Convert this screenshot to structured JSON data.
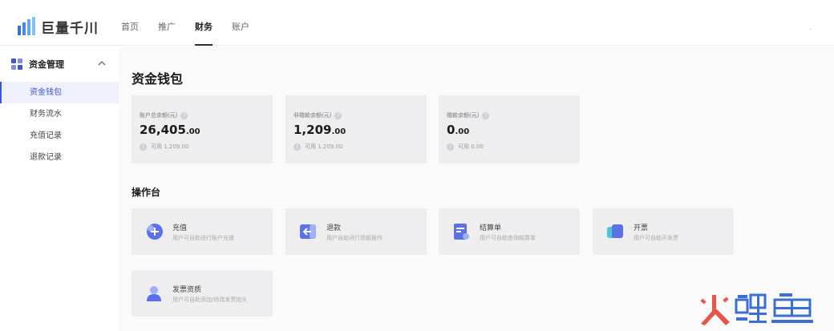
{
  "header": {
    "logo_text": "巨量千川",
    "nav": [
      {
        "label": "首页",
        "active": false
      },
      {
        "label": "推广",
        "active": false
      },
      {
        "label": "财务",
        "active": true
      },
      {
        "label": "账户",
        "active": false
      }
    ],
    "right_mark": "."
  },
  "sidebar": {
    "group_label": "资金管理",
    "items": [
      {
        "label": "资金钱包",
        "active": true
      },
      {
        "label": "财务流水",
        "active": false
      },
      {
        "label": "充值记录",
        "active": false
      },
      {
        "label": "退款记录",
        "active": false
      }
    ]
  },
  "main": {
    "title": "资金钱包",
    "cards": [
      {
        "label": "账户总余额(元)",
        "amount_int": "26,405",
        "amount_dec": ".00",
        "available": "可用 1,209.00"
      },
      {
        "label": "非赠款余额(元)",
        "amount_int": "1,209",
        "amount_dec": ".00",
        "available": "可用 1,209.00"
      },
      {
        "label": "赠款余额(元)",
        "amount_int": "0",
        "amount_dec": ".00",
        "available": "可用 0.00"
      }
    ],
    "ops_title": "操作台",
    "ops": [
      {
        "title": "充值",
        "desc": "用户可自助进行账户充值",
        "icon": "add-icon"
      },
      {
        "title": "退款",
        "desc": "用户自助进行退款操作",
        "icon": "refund-icon"
      },
      {
        "title": "结算单",
        "desc": "用户可自助查询结算单",
        "icon": "statement-icon"
      },
      {
        "title": "开票",
        "desc": "用户可自助开发票",
        "icon": "invoice-icon"
      },
      {
        "title": "发票资质",
        "desc": "用户可自助添加/修改发票抬头",
        "icon": "qualification-icon"
      }
    ]
  },
  "watermark": {
    "text": "火鲤鱼"
  },
  "colors": {
    "accent": "#3c56d6",
    "icon_blue": "#5b72e6",
    "card_bg": "#eeeef0",
    "watermark_red": "#e8544a",
    "watermark_blue": "#3b6fd4"
  }
}
